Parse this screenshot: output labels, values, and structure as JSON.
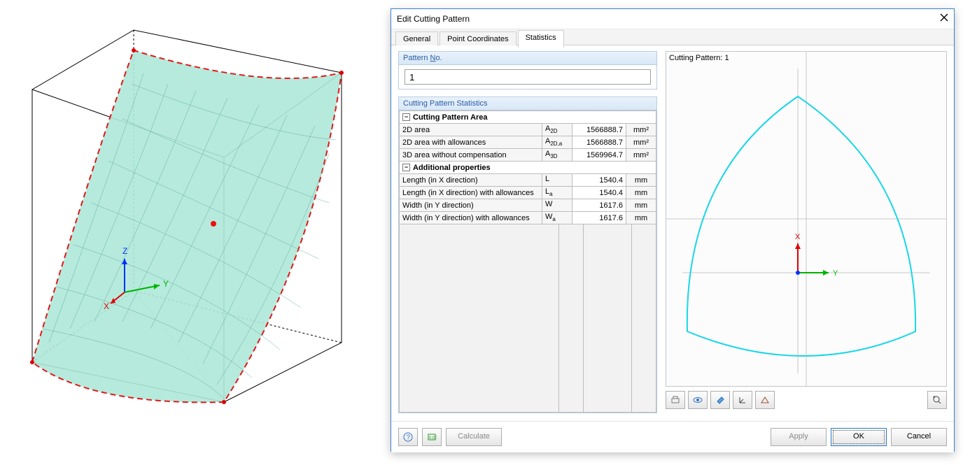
{
  "dialog": {
    "title": "Edit Cutting Pattern",
    "tabs": {
      "general": "General",
      "pointcoord": "Point Coordinates",
      "statistics": "Statistics"
    },
    "patternno_group": "Pattern No.",
    "patternno_label": "Pattern No.",
    "patternno_value": "1",
    "stats_group": "Cutting Pattern Statistics",
    "section1": "Cutting Pattern Area",
    "section2": "Additional properties",
    "rows": {
      "r1": {
        "label": "2D area",
        "sym": "A",
        "sub": "2D",
        "val": "1566888.7",
        "unit": "mm²"
      },
      "r2": {
        "label": "2D area with allowances",
        "sym": "A",
        "sub": "2D,a",
        "val": "1566888.7",
        "unit": "mm²"
      },
      "r3": {
        "label": "3D area without compensation",
        "sym": "A",
        "sub": "3D",
        "val": "1569964.7",
        "unit": "mm²"
      },
      "r4": {
        "label": "Length (in X direction)",
        "sym": "L",
        "sub": "",
        "val": "1540.4",
        "unit": "mm"
      },
      "r5": {
        "label": "Length (in X direction) with allowances",
        "sym": "L",
        "sub": "a",
        "val": "1540.4",
        "unit": "mm"
      },
      "r6": {
        "label": "Width (in Y direction)",
        "sym": "W",
        "sub": "",
        "val": "1617.6",
        "unit": "mm"
      },
      "r7": {
        "label": "Width (in Y direction) with allowances",
        "sym": "W",
        "sub": "a",
        "val": "1617.6",
        "unit": "mm"
      }
    },
    "preview_label": "Cutting Pattern: 1",
    "axis_x": "X",
    "axis_y": "Y",
    "footer": {
      "calculate": "Calculate",
      "apply": "Apply",
      "ok": "OK",
      "cancel": "Cancel"
    }
  },
  "viewport_axes": {
    "x": "X",
    "y": "Y",
    "z": "Z"
  }
}
